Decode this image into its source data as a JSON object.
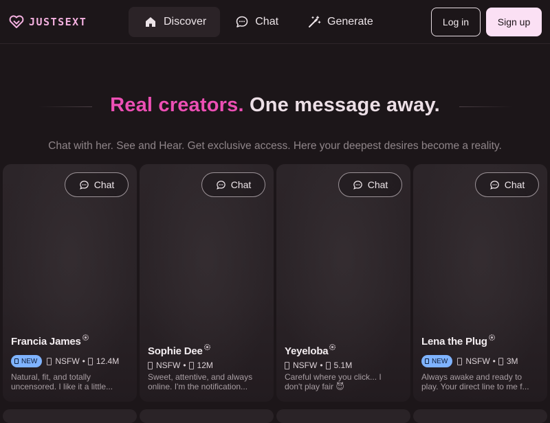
{
  "brand": {
    "name": "JUSTSEXT"
  },
  "nav": {
    "items": [
      {
        "label": "Discover",
        "icon": "home-icon",
        "active": true
      },
      {
        "label": "Chat",
        "icon": "chat-bubble-icon",
        "active": false
      },
      {
        "label": "Generate",
        "icon": "magic-wand-icon",
        "active": false
      }
    ],
    "login_label": "Log in",
    "signup_label": "Sign up"
  },
  "hero": {
    "title_accent": "Real creators.",
    "title_rest": "One message away.",
    "subtitle": "Chat with her. See and Hear. Get exclusive access. Here your deepest desires become a reality."
  },
  "cards": [
    {
      "chat_label": "Chat",
      "name": "Francia James",
      "is_new": true,
      "new_label": "NEW",
      "rating": "NSFW",
      "separator": "•",
      "followers": "12.4M",
      "description_line1": "Natural, fit, and totally",
      "description_line2": "uncensored. I like it a little..."
    },
    {
      "chat_label": "Chat",
      "name": "Sophie Dee",
      "is_new": false,
      "rating": "NSFW",
      "separator": "•",
      "followers": "12M",
      "description_line1": "Sweet, attentive, and always",
      "description_line2": "online. I'm the notification..."
    },
    {
      "chat_label": "Chat",
      "name": "Yeyeloba",
      "is_new": false,
      "rating": "NSFW",
      "separator": "•",
      "followers": "5.1M",
      "description_line1": "Careful where you click... I",
      "description_line2": "don't play fair 😈"
    },
    {
      "chat_label": "Chat",
      "name": "Lena the Plug",
      "is_new": true,
      "new_label": "NEW",
      "rating": "NSFW",
      "separator": "•",
      "followers": "3M",
      "description_line1": "Always awake and ready to",
      "description_line2": "play. Your direct line to me f..."
    }
  ],
  "colors": {
    "background": "#1c1619",
    "accent_pink": "#ec4fb4",
    "logo_pink": "#f3b0df",
    "signup_bg": "#fbe0f4",
    "new_badge": "#7fb3ff"
  }
}
